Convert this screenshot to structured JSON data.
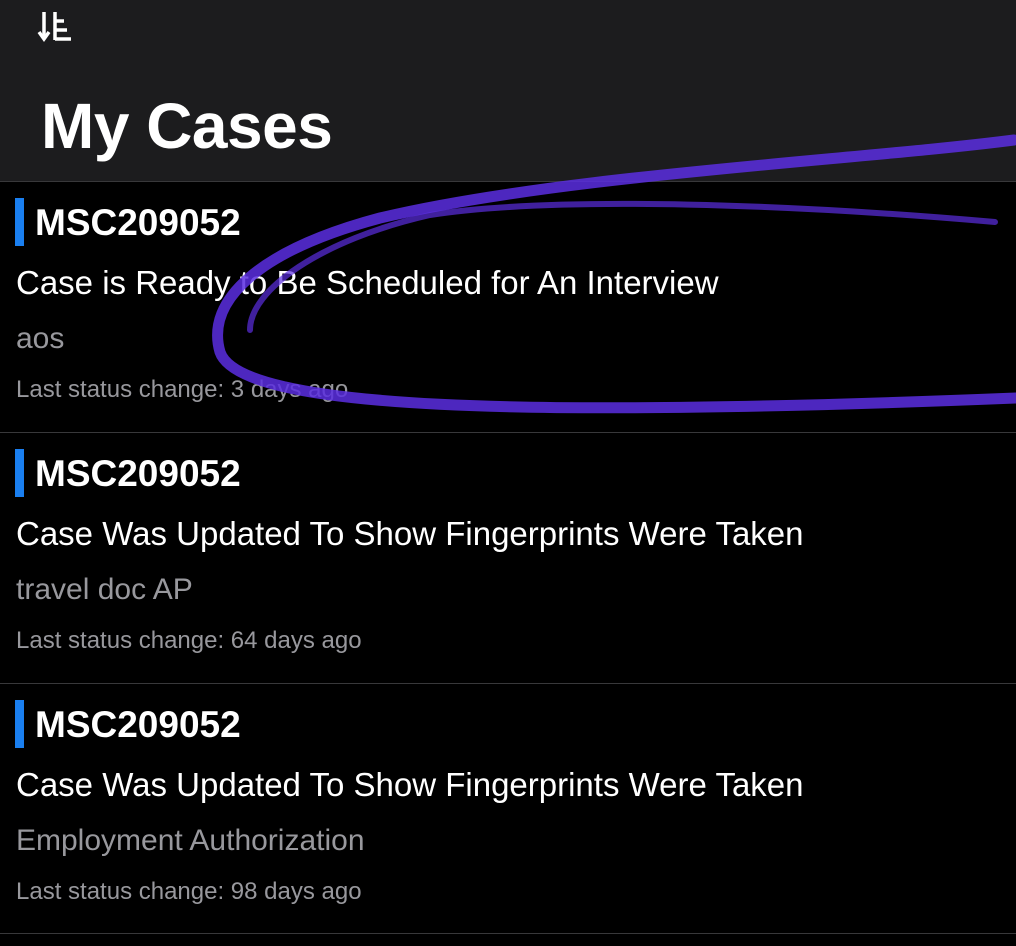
{
  "header": {
    "sort_icon": "sort-descending-icon",
    "title": "My Cases"
  },
  "colors": {
    "background": "#000000",
    "header_background": "#1c1c1e",
    "accent": "#1a7ff0",
    "secondary_text": "#98989d",
    "annotation_stroke": "#5b2ee0"
  },
  "cases": [
    {
      "number": "MSC209052",
      "status": "Case is Ready to Be Scheduled for An Interview",
      "type": "aos",
      "updated": "Last status change: 3 days ago"
    },
    {
      "number": "MSC209052",
      "status": "Case Was Updated To Show Fingerprints Were Taken",
      "type": "travel doc AP",
      "updated": "Last status change: 64 days ago"
    },
    {
      "number": "MSC209052",
      "status": "Case Was Updated To Show Fingerprints Were Taken",
      "type": "Employment Authorization",
      "updated": "Last status change: 98 days ago"
    }
  ]
}
